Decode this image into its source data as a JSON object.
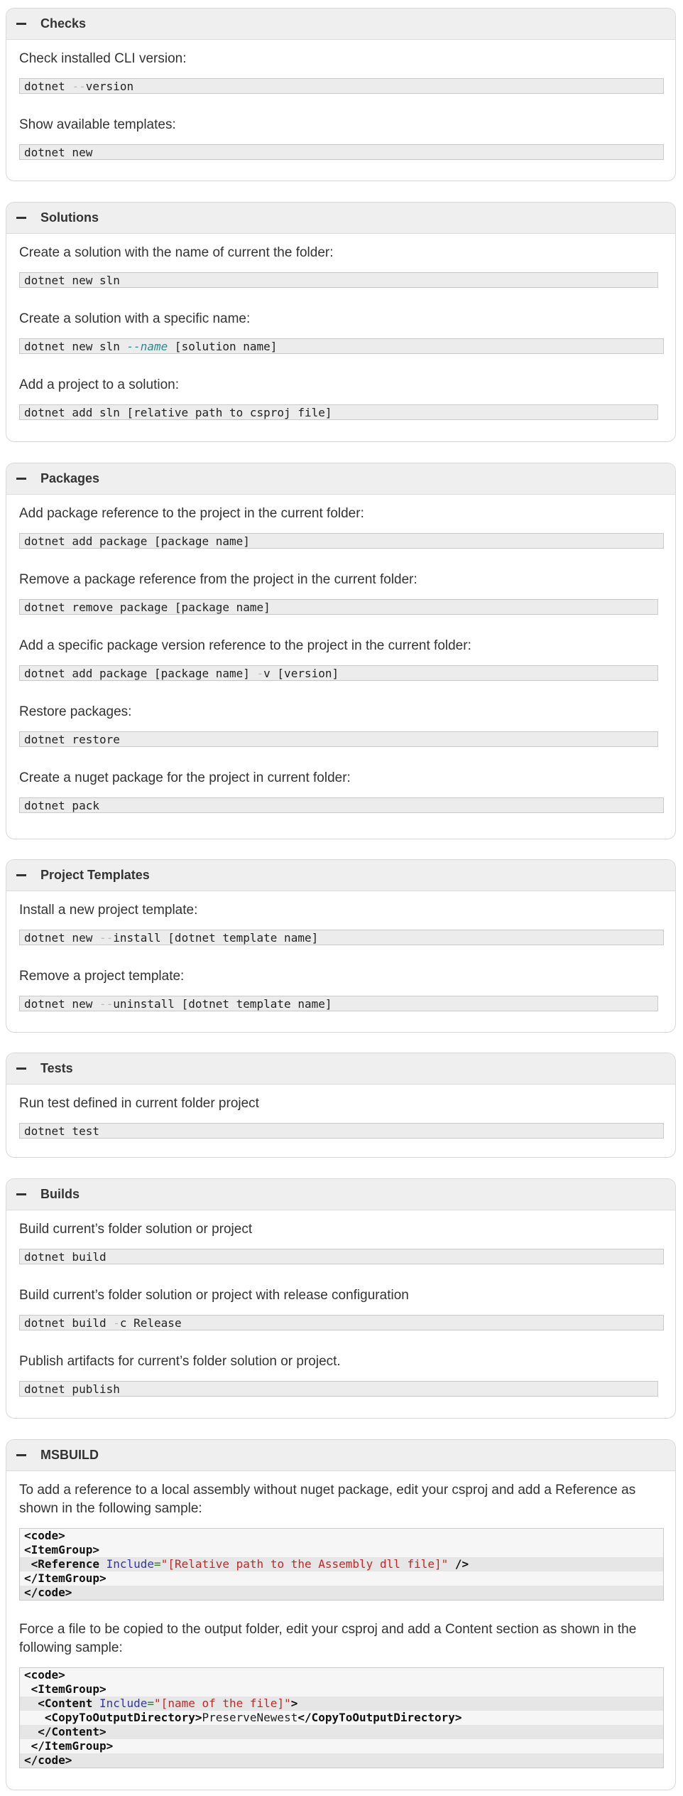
{
  "sections": {
    "checks": {
      "title": "Checks",
      "items": [
        {
          "desc": "Check installed CLI version:",
          "cmd_a": "dotnet ",
          "cmd_dash": "--",
          "cmd_b": "version"
        },
        {
          "desc": "Show available templates:",
          "cmd": "dotnet new"
        }
      ]
    },
    "solutions": {
      "title": "Solutions",
      "items": [
        {
          "desc": "Create a solution with the name of current the folder:",
          "cmd": "dotnet new sln"
        },
        {
          "desc": "Create a solution with a specific name:",
          "cmd_a": "dotnet new sln ",
          "cmd_opt": "--name",
          "cmd_b": " [solution name]"
        },
        {
          "desc": "Add a project to a solution:",
          "cmd": "dotnet add sln [relative path to csproj file]"
        }
      ]
    },
    "packages": {
      "title": "Packages",
      "items": [
        {
          "desc": "Add package reference to the project in the current folder:",
          "cmd": "dotnet add package [package name]"
        },
        {
          "desc": "Remove a package reference from the project in the current folder:",
          "cmd": "dotnet remove package [package name]"
        },
        {
          "desc": "Add a specific package version reference to the project in the current folder:",
          "cmd_a": "dotnet add package [package name] ",
          "cmd_dash": "-",
          "cmd_b": "v [version]"
        },
        {
          "desc": "Restore packages:",
          "cmd": "dotnet restore"
        },
        {
          "desc": "Create a nuget package for the project in current folder:",
          "cmd": "dotnet pack"
        }
      ]
    },
    "templates": {
      "title": "Project Templates",
      "items": [
        {
          "desc": "Install a new project template:",
          "cmd_a": "dotnet new ",
          "cmd_dash": "--",
          "cmd_b": "install [dotnet template name]"
        },
        {
          "desc": "Remove a project template:",
          "cmd_a": "dotnet new ",
          "cmd_dash": "--",
          "cmd_b": "uninstall [dotnet template name]"
        }
      ]
    },
    "tests": {
      "title": "Tests",
      "items": [
        {
          "desc": "Run test defined in current folder project",
          "cmd": "dotnet test"
        }
      ]
    },
    "builds": {
      "title": "Builds",
      "items": [
        {
          "desc": "Build current’s folder solution or project",
          "cmd": "dotnet build"
        },
        {
          "desc": "Build current’s folder solution or project with release configuration",
          "cmd_a": "dotnet build ",
          "cmd_dash": "-",
          "cmd_b": "c Release"
        },
        {
          "desc": "Publish artifacts for current’s folder solution or project.",
          "cmd": "dotnet publish"
        }
      ]
    },
    "msbuild": {
      "title": "MSBUILD",
      "desc1": "To add a reference to a local assembly without nuget package, edit your csproj and add a Reference as shown in the following sample:",
      "code1": {
        "code_open": "<code>",
        "itemgroup_open": "<ItemGroup>",
        "ref_tag": "<Reference",
        "ref_attr": "Include",
        "eq": "=",
        "ref_value": "\"[Relative path to the Assembly dll file]\"",
        "ref_close": "/>",
        "itemgroup_close": "</ItemGroup>",
        "code_close": "</code>"
      },
      "desc2": "Force a file to be copied to the output folder, edit your csproj and add a Content section as shown in the following sample:",
      "code2": {
        "code_open": "<code>",
        "itemgroup_open": "<ItemGroup>",
        "content_tag": "<Content",
        "content_attr": "Include",
        "eq": "=",
        "content_value": "\"[name of the file]\"",
        "content_gt": ">",
        "copy_open": "<CopyToOutputDirectory>",
        "copy_value": "PreserveNewest",
        "copy_close": "</CopyToOutputDirectory>",
        "content_close": "</Content>",
        "itemgroup_close": "</ItemGroup>",
        "code_close": "</code>"
      }
    }
  }
}
